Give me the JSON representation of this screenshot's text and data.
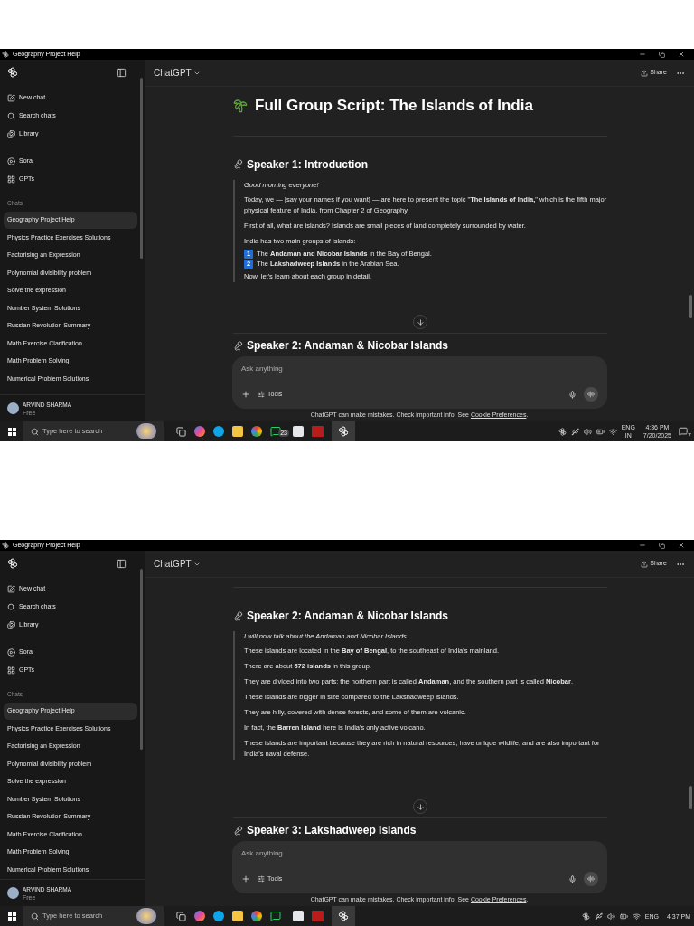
{
  "frames": [
    {
      "window_title": "Geography Project Help",
      "sidebar": {
        "nav": [
          "New chat",
          "Search chats",
          "Library"
        ],
        "nav2": [
          "Sora",
          "GPTs"
        ],
        "section": "Chats",
        "chats": [
          {
            "label": "Geography Project Help",
            "selected": true
          },
          {
            "label": "Physics Practice Exercises Solutions",
            "selected": false
          },
          {
            "label": "Factorising an Expression",
            "selected": false
          },
          {
            "label": "Polynomial divisibility problem",
            "selected": false
          },
          {
            "label": "Solve the expression",
            "selected": false
          },
          {
            "label": "Number System Solutions",
            "selected": false
          },
          {
            "label": "Russian Revolution Summary",
            "selected": false
          },
          {
            "label": "Math Exercise Clarification",
            "selected": false
          },
          {
            "label": "Math Problem Solving",
            "selected": false
          },
          {
            "label": "Numerical Problem Solutions",
            "selected": false
          }
        ],
        "user": {
          "name": "ARVIND SHARMA",
          "plan": "Free"
        }
      },
      "header": {
        "model": "ChatGPT",
        "share": "Share"
      },
      "content": [
        {
          "kind": "title",
          "text": "Full Group Script: The Islands of India"
        },
        {
          "kind": "divider"
        },
        {
          "kind": "heading",
          "text": "Speaker 1: Introduction"
        },
        {
          "kind": "quote",
          "paragraphs": [
            {
              "kind": "italic",
              "text": "Good morning everyone!"
            },
            {
              "kind": "text",
              "text": "Today, we — [say your names if you want] — are here to present the topic \"**The Islands of India,**\" which is the fifth major physical feature of India, from Chapter 2 of Geography."
            },
            {
              "kind": "text",
              "text": "First of all, what are islands? Islands are small pieces of land completely surrounded by water."
            },
            {
              "kind": "text",
              "text": "India has two main groups of islands:"
            },
            {
              "kind": "numbered",
              "number": "1",
              "text": "The **Andaman and Nicobar Islands** in the Bay of Bengal."
            },
            {
              "kind": "numbered",
              "number": "2",
              "text": "The **Lakshadweep Islands** in the Arabian Sea."
            },
            {
              "kind": "text",
              "text": "Now, let's learn about each group in detail."
            }
          ]
        }
      ],
      "next_heading": "Speaker 2: Andaman & Nicobar Islands",
      "composer": {
        "placeholder": "Ask anything",
        "tools": "Tools"
      },
      "disclaimer": "ChatGPT can make mistakes. Check important info. See",
      "disclaimer_link": "Cookie Preferences",
      "disclaimer_end": ".",
      "taskbar": {
        "search_placeholder": "Type here to search",
        "badge": "23",
        "lang": "ENG",
        "region": "IN",
        "time": "4:36 PM",
        "date": "7/20/2025",
        "notifications": "7"
      }
    },
    {
      "window_title": "Geography Project Help",
      "sidebar": {
        "nav": [
          "New chat",
          "Search chats",
          "Library"
        ],
        "nav2": [
          "Sora",
          "GPTs"
        ],
        "section": "Chats",
        "chats": [
          {
            "label": "Geography Project Help",
            "selected": true
          },
          {
            "label": "Physics Practice Exercises Solutions",
            "selected": false
          },
          {
            "label": "Factorising an Expression",
            "selected": false
          },
          {
            "label": "Polynomial divisibility problem",
            "selected": false
          },
          {
            "label": "Solve the expression",
            "selected": false
          },
          {
            "label": "Number System Solutions",
            "selected": false
          },
          {
            "label": "Russian Revolution Summary",
            "selected": false
          },
          {
            "label": "Math Exercise Clarification",
            "selected": false
          },
          {
            "label": "Math Problem Solving",
            "selected": false
          },
          {
            "label": "Numerical Problem Solutions",
            "selected": false
          }
        ],
        "user": {
          "name": "ARVIND SHARMA",
          "plan": "Free"
        }
      },
      "header": {
        "model": "ChatGPT",
        "share": "Share"
      },
      "content": [
        {
          "kind": "divider"
        },
        {
          "kind": "heading",
          "text": "Speaker 2: Andaman & Nicobar Islands"
        },
        {
          "kind": "quote",
          "paragraphs": [
            {
              "kind": "italic",
              "text": "I will now talk about the Andaman and Nicobar Islands."
            },
            {
              "kind": "text",
              "text": "These islands are located in the **Bay of Bengal**, to the southeast of India's mainland."
            },
            {
              "kind": "text",
              "text": "There are about **572 islands** in this group."
            },
            {
              "kind": "text",
              "text": "They are divided into two parts: the northern part is called **Andaman**, and the southern part is called **Nicobar**."
            },
            {
              "kind": "text",
              "text": "These islands are bigger in size compared to the Lakshadweep islands."
            },
            {
              "kind": "text",
              "text": "They are hilly, covered with dense forests, and some of them are volcanic."
            },
            {
              "kind": "text",
              "text": "In fact, the **Barren Island** here is India's only active volcano."
            },
            {
              "kind": "text",
              "text": "These islands are important because they are rich in natural resources, have unique wildlife, and are also important for India's naval defense."
            }
          ]
        }
      ],
      "next_heading": "Speaker 3: Lakshadweep Islands",
      "composer": {
        "placeholder": "Ask anything",
        "tools": "Tools"
      },
      "disclaimer": "ChatGPT can make mistakes. Check important info. See",
      "disclaimer_link": "Cookie Preferences",
      "disclaimer_end": ".",
      "taskbar": {
        "search_placeholder": "Type here to search",
        "lang": "ENG",
        "time": "4:37 PM"
      }
    }
  ]
}
